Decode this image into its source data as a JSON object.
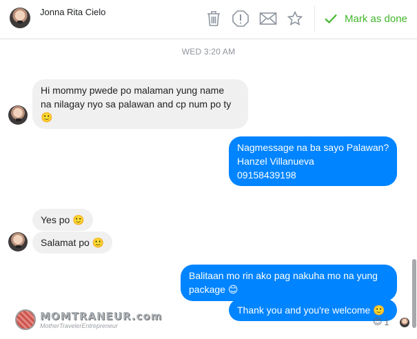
{
  "contact": {
    "name": "Jonna Rita Cielo"
  },
  "toolbar": {
    "delete_icon": "trash-icon",
    "report_icon": "alert-icon",
    "email_icon": "envelope-icon",
    "star_icon": "star-icon",
    "mark_done_label": "Mark as done",
    "accent_color": "#42b72a"
  },
  "conversation": {
    "timestamp": "WED 3:20 AM",
    "messages": [
      {
        "dir": "in",
        "line1": "Hi mommy pwede po malaman yung name",
        "line2": "na nilagay nyo sa palawan and cp num po ty",
        "emoji": "🙂"
      },
      {
        "dir": "out",
        "line1": "Nagmessage na ba sayo Palawan?",
        "line2": "Hanzel Villanueva",
        "line3": "09158439198"
      },
      {
        "dir": "in",
        "text": "Yes po",
        "emoji": "🙂"
      },
      {
        "dir": "in",
        "text": "Salamat po",
        "emoji": "🙂"
      },
      {
        "dir": "out",
        "line1": "Balitaan mo rin ako pag nakuha mo na yung",
        "line2": "package",
        "emoji": "😊"
      },
      {
        "dir": "out",
        "text": "Thank you and you're welcome",
        "emoji": "🙂"
      }
    ],
    "reaction": {
      "emoji": "😍",
      "count": "1"
    }
  },
  "colors": {
    "outgoing_bubble": "#0084ff",
    "incoming_bubble": "#f1f0f0"
  },
  "watermark": {
    "title": "MOMTRANEUR.com",
    "subtitle": "MotherTravelerEntrepreneur"
  }
}
